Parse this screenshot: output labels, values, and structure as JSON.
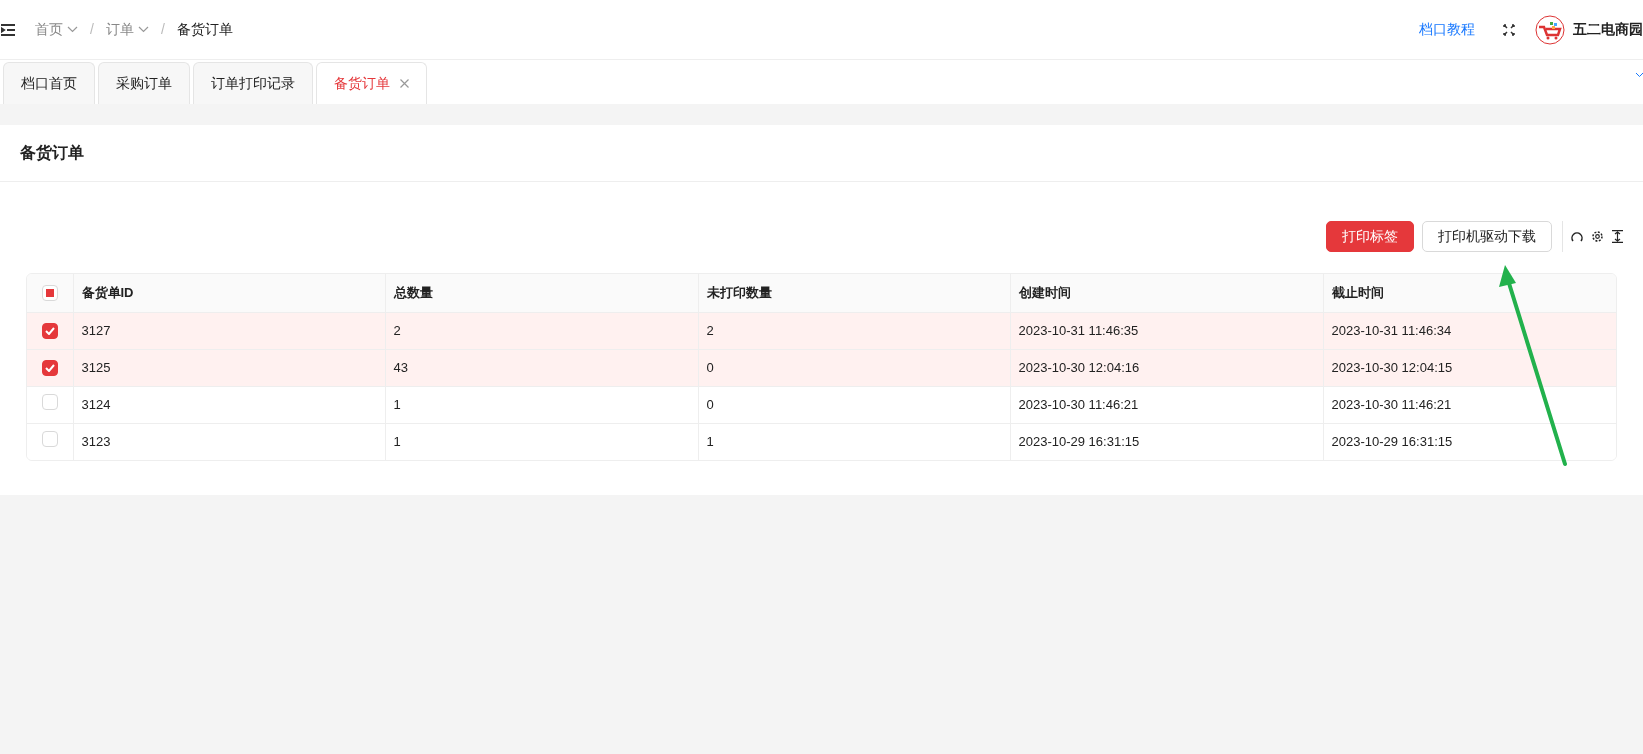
{
  "breadcrumbs": [
    {
      "label": "首页",
      "dropdown": true
    },
    {
      "separator": "/",
      "label": "订单",
      "dropdown": true
    },
    {
      "separator": "/",
      "label": "备货订单",
      "dropdown": false
    }
  ],
  "header_link": "档口教程",
  "user_name": "五二电商园",
  "tabs": [
    {
      "label": "档口首页",
      "selected": false,
      "closable": false
    },
    {
      "label": "采购订单",
      "selected": false,
      "closable": false
    },
    {
      "label": "订单打印记录",
      "selected": false,
      "closable": false
    },
    {
      "label": "备货订单",
      "selected": true,
      "closable": true
    }
  ],
  "page_title": "备货订单",
  "buttons": [
    {
      "label": "打印标签",
      "kind": "primary"
    },
    {
      "label": "打印机驱动下载",
      "kind": "default"
    }
  ],
  "table": {
    "select_all_indeterminate": true,
    "columns": [
      "备货单ID",
      "总数量",
      "未打印数量",
      "创建时间",
      "截止时间"
    ],
    "rows": [
      {
        "selected": true,
        "cells": [
          "3127",
          "2",
          "2",
          "2023-10-31 11:46:35",
          "2023-10-31 11:46:34"
        ]
      },
      {
        "selected": true,
        "cells": [
          "3125",
          "43",
          "0",
          "2023-10-30 12:04:16",
          "2023-10-30 12:04:15"
        ]
      },
      {
        "selected": false,
        "cells": [
          "3124",
          "1",
          "0",
          "2023-10-30 11:46:21",
          "2023-10-30 11:46:21"
        ]
      },
      {
        "selected": false,
        "cells": [
          "3123",
          "1",
          "1",
          "2023-10-29 16:31:15",
          "2023-10-29 16:31:15"
        ]
      }
    ]
  }
}
